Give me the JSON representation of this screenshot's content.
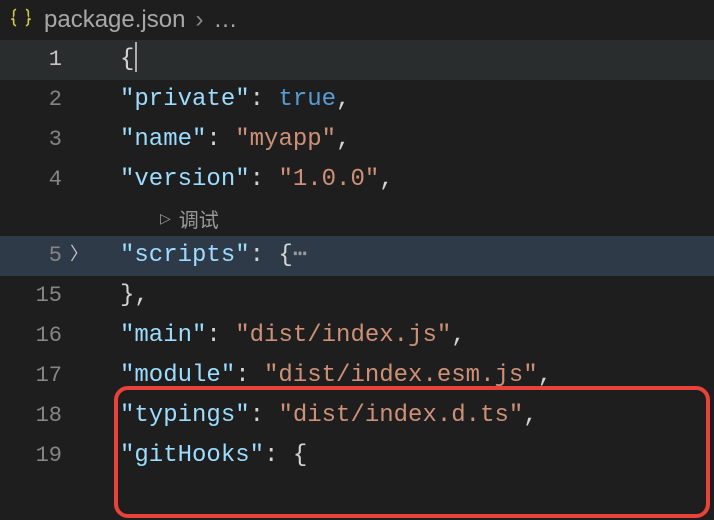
{
  "breadcrumb": {
    "filename": "package.json",
    "sep": "›",
    "dots": "…"
  },
  "codelens": {
    "label": "调试"
  },
  "lines": {
    "l1": {
      "num": "1"
    },
    "l2": {
      "num": "2",
      "key": "\"private\"",
      "val": "true"
    },
    "l3": {
      "num": "3",
      "key": "\"name\"",
      "val": "\"myapp\""
    },
    "l4": {
      "num": "4",
      "key": "\"version\"",
      "val": "\"1.0.0\""
    },
    "l5": {
      "num": "5",
      "key": "\"scripts\"",
      "dots": "⋯"
    },
    "l15": {
      "num": "15"
    },
    "l16": {
      "num": "16",
      "key": "\"main\"",
      "val": "\"dist/index.js\""
    },
    "l17": {
      "num": "17",
      "key": "\"module\"",
      "val": "\"dist/index.esm.js\""
    },
    "l18": {
      "num": "18",
      "key": "\"typings\"",
      "val": "\"dist/index.d.ts\""
    },
    "l19": {
      "num": "19",
      "key": "\"gitHooks\""
    }
  }
}
